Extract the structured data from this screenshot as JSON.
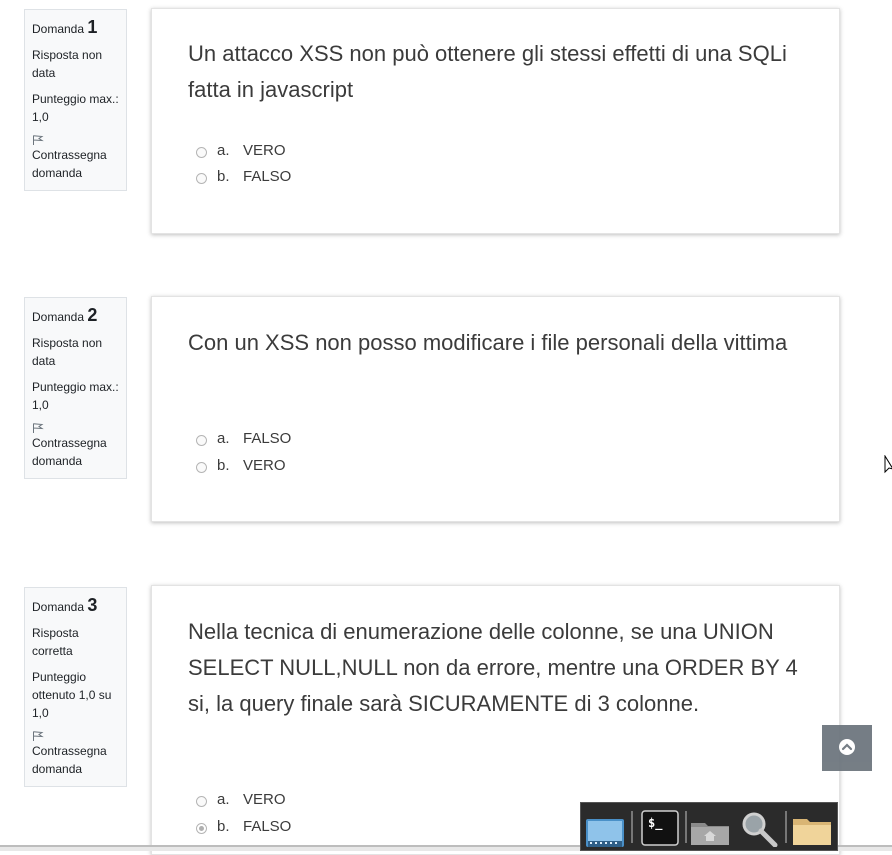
{
  "questions": [
    {
      "label": "Domanda",
      "number": "1",
      "state": "Risposta non data",
      "grade": "Punteggio max.: 1,0",
      "flag": "Contrassegna domanda",
      "text": "Un attacco XSS non può ottenere gli stessi effetti di una SQLi fatta in javascript",
      "answers": [
        {
          "letter": "a.",
          "text": "VERO",
          "selected": false
        },
        {
          "letter": "b.",
          "text": "FALSO",
          "selected": false
        }
      ]
    },
    {
      "label": "Domanda",
      "number": "2",
      "state": "Risposta non data",
      "grade": "Punteggio max.: 1,0",
      "flag": "Contrassegna domanda",
      "text": "Con un XSS non posso modificare i file personali della vittima",
      "answers": [
        {
          "letter": "a.",
          "text": "FALSO",
          "selected": false
        },
        {
          "letter": "b.",
          "text": "VERO",
          "selected": false
        }
      ]
    },
    {
      "label": "Domanda",
      "number": "3",
      "state": "Risposta corretta",
      "grade": "Punteggio ottenuto 1,0 su 1,0",
      "flag": "Contrassegna domanda",
      "text": "Nella tecnica di enumerazione delle colonne, se una UNION SELECT NULL,NULL non da errore, mentre una ORDER BY 4 si, la query finale sarà SICURAMENTE di 3 colonne.",
      "answers": [
        {
          "letter": "a.",
          "text": "VERO",
          "selected": false
        },
        {
          "letter": "b.",
          "text": "FALSO",
          "selected": true
        }
      ]
    }
  ],
  "dock": {
    "items": [
      "show-desktop-icon",
      "terminal-icon",
      "home-folder-icon",
      "search-icon",
      "files-icon"
    ],
    "terminal_glyph": "$_"
  },
  "colors": {
    "info_bg": "#f8f9fa",
    "question_text": "#3b3b3b",
    "back_to_top_bg": "#6a737b"
  }
}
